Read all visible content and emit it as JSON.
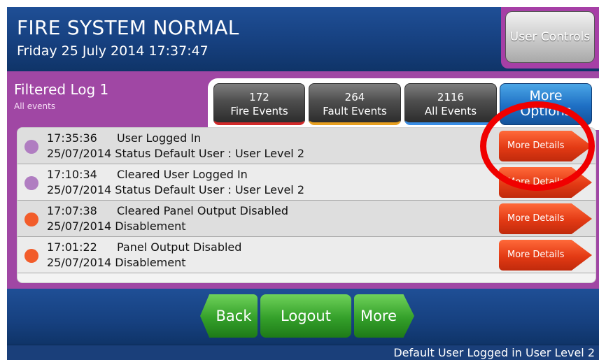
{
  "header": {
    "title": "FIRE SYSTEM NORMAL",
    "datetime": "Friday 25 July 2014 17:37:47",
    "user_controls_label": "User Controls"
  },
  "log": {
    "title": "Filtered Log 1",
    "subtitle": "All events",
    "tabs": [
      {
        "count": "172",
        "label": "Fire Events"
      },
      {
        "count": "264",
        "label": "Fault Events"
      },
      {
        "count": "2116",
        "label": "All Events"
      },
      {
        "line1": "More",
        "line2": "Options"
      }
    ]
  },
  "events": [
    {
      "time": "17:35:36",
      "description": "User Logged In",
      "detail": "25/07/2014 Status Default User : User Level 2",
      "indicator": "purple",
      "button": "More Details"
    },
    {
      "time": "17:10:34",
      "description": "Cleared User Logged In",
      "detail": "25/07/2014 Status Default User : User Level 2",
      "indicator": "purple",
      "button": "More Details"
    },
    {
      "time": "17:07:38",
      "description": "Cleared Panel Output Disabled",
      "detail": "25/07/2014 Disablement",
      "indicator": "orange",
      "button": "More Details"
    },
    {
      "time": "17:01:22",
      "description": "Panel Output Disabled",
      "detail": "25/07/2014 Disablement",
      "indicator": "orange",
      "button": "More Details"
    }
  ],
  "footer": {
    "back_label": "Back",
    "logout_label": "Logout",
    "more_label": "More",
    "status_text": "Default User Logged in User Level 2"
  },
  "colors": {
    "header_blue": "#16407f",
    "panel_purple": "#a047a4",
    "button_red": "#e33a14",
    "nav_green": "#34a02a",
    "highlight_red": "#f00000"
  }
}
